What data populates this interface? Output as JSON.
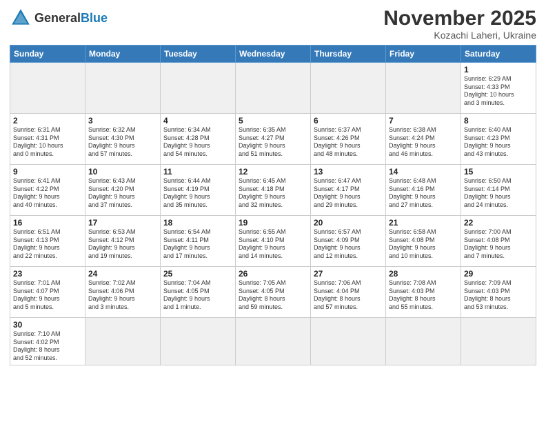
{
  "header": {
    "logo_general": "General",
    "logo_blue": "Blue",
    "main_title": "November 2025",
    "subtitle": "Kozachi Laheri, Ukraine"
  },
  "days_of_week": [
    "Sunday",
    "Monday",
    "Tuesday",
    "Wednesday",
    "Thursday",
    "Friday",
    "Saturday"
  ],
  "weeks": [
    [
      {
        "day": "",
        "info": "",
        "empty": true
      },
      {
        "day": "",
        "info": "",
        "empty": true
      },
      {
        "day": "",
        "info": "",
        "empty": true
      },
      {
        "day": "",
        "info": "",
        "empty": true
      },
      {
        "day": "",
        "info": "",
        "empty": true
      },
      {
        "day": "",
        "info": "",
        "empty": true
      },
      {
        "day": "1",
        "info": "Sunrise: 6:29 AM\nSunset: 4:33 PM\nDaylight: 10 hours\nand 3 minutes.",
        "empty": false
      }
    ],
    [
      {
        "day": "2",
        "info": "Sunrise: 6:31 AM\nSunset: 4:31 PM\nDaylight: 10 hours\nand 0 minutes.",
        "empty": false
      },
      {
        "day": "3",
        "info": "Sunrise: 6:32 AM\nSunset: 4:30 PM\nDaylight: 9 hours\nand 57 minutes.",
        "empty": false
      },
      {
        "day": "4",
        "info": "Sunrise: 6:34 AM\nSunset: 4:28 PM\nDaylight: 9 hours\nand 54 minutes.",
        "empty": false
      },
      {
        "day": "5",
        "info": "Sunrise: 6:35 AM\nSunset: 4:27 PM\nDaylight: 9 hours\nand 51 minutes.",
        "empty": false
      },
      {
        "day": "6",
        "info": "Sunrise: 6:37 AM\nSunset: 4:26 PM\nDaylight: 9 hours\nand 48 minutes.",
        "empty": false
      },
      {
        "day": "7",
        "info": "Sunrise: 6:38 AM\nSunset: 4:24 PM\nDaylight: 9 hours\nand 46 minutes.",
        "empty": false
      },
      {
        "day": "8",
        "info": "Sunrise: 6:40 AM\nSunset: 4:23 PM\nDaylight: 9 hours\nand 43 minutes.",
        "empty": false
      }
    ],
    [
      {
        "day": "9",
        "info": "Sunrise: 6:41 AM\nSunset: 4:22 PM\nDaylight: 9 hours\nand 40 minutes.",
        "empty": false
      },
      {
        "day": "10",
        "info": "Sunrise: 6:43 AM\nSunset: 4:20 PM\nDaylight: 9 hours\nand 37 minutes.",
        "empty": false
      },
      {
        "day": "11",
        "info": "Sunrise: 6:44 AM\nSunset: 4:19 PM\nDaylight: 9 hours\nand 35 minutes.",
        "empty": false
      },
      {
        "day": "12",
        "info": "Sunrise: 6:45 AM\nSunset: 4:18 PM\nDaylight: 9 hours\nand 32 minutes.",
        "empty": false
      },
      {
        "day": "13",
        "info": "Sunrise: 6:47 AM\nSunset: 4:17 PM\nDaylight: 9 hours\nand 29 minutes.",
        "empty": false
      },
      {
        "day": "14",
        "info": "Sunrise: 6:48 AM\nSunset: 4:16 PM\nDaylight: 9 hours\nand 27 minutes.",
        "empty": false
      },
      {
        "day": "15",
        "info": "Sunrise: 6:50 AM\nSunset: 4:14 PM\nDaylight: 9 hours\nand 24 minutes.",
        "empty": false
      }
    ],
    [
      {
        "day": "16",
        "info": "Sunrise: 6:51 AM\nSunset: 4:13 PM\nDaylight: 9 hours\nand 22 minutes.",
        "empty": false
      },
      {
        "day": "17",
        "info": "Sunrise: 6:53 AM\nSunset: 4:12 PM\nDaylight: 9 hours\nand 19 minutes.",
        "empty": false
      },
      {
        "day": "18",
        "info": "Sunrise: 6:54 AM\nSunset: 4:11 PM\nDaylight: 9 hours\nand 17 minutes.",
        "empty": false
      },
      {
        "day": "19",
        "info": "Sunrise: 6:55 AM\nSunset: 4:10 PM\nDaylight: 9 hours\nand 14 minutes.",
        "empty": false
      },
      {
        "day": "20",
        "info": "Sunrise: 6:57 AM\nSunset: 4:09 PM\nDaylight: 9 hours\nand 12 minutes.",
        "empty": false
      },
      {
        "day": "21",
        "info": "Sunrise: 6:58 AM\nSunset: 4:08 PM\nDaylight: 9 hours\nand 10 minutes.",
        "empty": false
      },
      {
        "day": "22",
        "info": "Sunrise: 7:00 AM\nSunset: 4:08 PM\nDaylight: 9 hours\nand 7 minutes.",
        "empty": false
      }
    ],
    [
      {
        "day": "23",
        "info": "Sunrise: 7:01 AM\nSunset: 4:07 PM\nDaylight: 9 hours\nand 5 minutes.",
        "empty": false
      },
      {
        "day": "24",
        "info": "Sunrise: 7:02 AM\nSunset: 4:06 PM\nDaylight: 9 hours\nand 3 minutes.",
        "empty": false
      },
      {
        "day": "25",
        "info": "Sunrise: 7:04 AM\nSunset: 4:05 PM\nDaylight: 9 hours\nand 1 minute.",
        "empty": false
      },
      {
        "day": "26",
        "info": "Sunrise: 7:05 AM\nSunset: 4:05 PM\nDaylight: 8 hours\nand 59 minutes.",
        "empty": false
      },
      {
        "day": "27",
        "info": "Sunrise: 7:06 AM\nSunset: 4:04 PM\nDaylight: 8 hours\nand 57 minutes.",
        "empty": false
      },
      {
        "day": "28",
        "info": "Sunrise: 7:08 AM\nSunset: 4:03 PM\nDaylight: 8 hours\nand 55 minutes.",
        "empty": false
      },
      {
        "day": "29",
        "info": "Sunrise: 7:09 AM\nSunset: 4:03 PM\nDaylight: 8 hours\nand 53 minutes.",
        "empty": false
      }
    ],
    [
      {
        "day": "30",
        "info": "Sunrise: 7:10 AM\nSunset: 4:02 PM\nDaylight: 8 hours\nand 52 minutes.",
        "empty": false
      },
      {
        "day": "",
        "info": "",
        "empty": true
      },
      {
        "day": "",
        "info": "",
        "empty": true
      },
      {
        "day": "",
        "info": "",
        "empty": true
      },
      {
        "day": "",
        "info": "",
        "empty": true
      },
      {
        "day": "",
        "info": "",
        "empty": true
      },
      {
        "day": "",
        "info": "",
        "empty": true
      }
    ]
  ]
}
